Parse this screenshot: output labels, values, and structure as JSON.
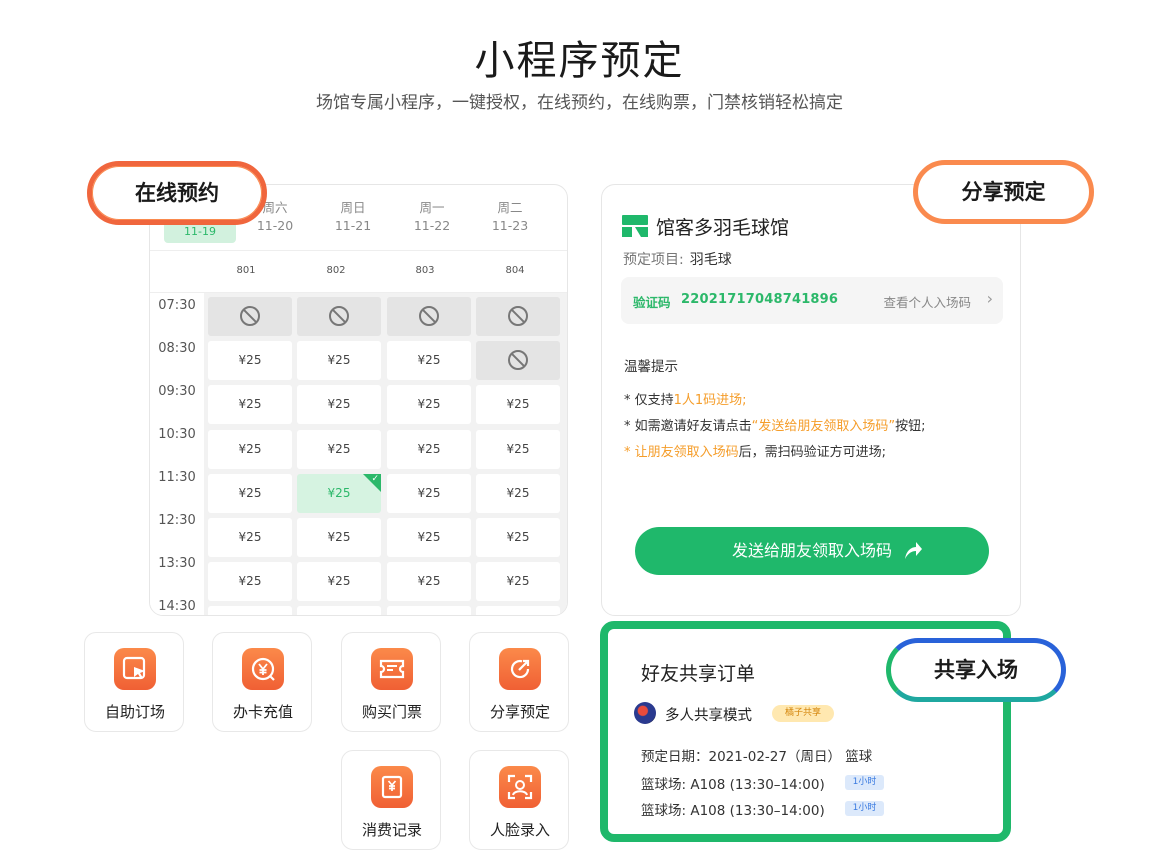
{
  "header": {
    "title": "小程序预定",
    "subtitle": "场馆专属小程序，一键授权，在线预约，在线购票，门禁核销轻松搞定"
  },
  "labels": {
    "online": "在线预约",
    "share": "分享预定",
    "enter": "共享入场"
  },
  "booking": {
    "selected_day": "11-19",
    "days": [
      {
        "week": "周六",
        "date": "11-20"
      },
      {
        "week": "周日",
        "date": "11-21"
      },
      {
        "week": "周一",
        "date": "11-22"
      },
      {
        "week": "周二",
        "date": "11-23"
      }
    ],
    "courts": [
      "801",
      "802",
      "803",
      "804"
    ],
    "times": [
      "07:30",
      "08:30",
      "09:30",
      "10:30",
      "11:30",
      "12:30",
      "13:30",
      "14:30"
    ],
    "price": "¥25",
    "rows": [
      [
        "off",
        "off",
        "off",
        "off"
      ],
      [
        "avail",
        "avail",
        "avail",
        "off"
      ],
      [
        "avail",
        "avail",
        "avail",
        "avail"
      ],
      [
        "avail",
        "avail",
        "avail",
        "avail"
      ],
      [
        "avail",
        "selected",
        "avail",
        "avail"
      ],
      [
        "avail",
        "avail",
        "avail",
        "avail"
      ],
      [
        "avail",
        "avail",
        "avail",
        "avail"
      ],
      [
        "avail",
        "avail",
        "avail",
        "avail"
      ]
    ]
  },
  "share_card": {
    "venue_name": "馆客多羽毛球馆",
    "project_label": "预定项目:",
    "project_value": "羽毛球",
    "code_label": "验证码",
    "code_value": "22021717048741896",
    "code_link": "查看个人入场码",
    "tips_title": "温馨提示",
    "tip1": {
      "prefix": "* 仅支持",
      "hl": "1人1码进场;",
      "suffix": ""
    },
    "tip2": {
      "prefix": "* 如需邀请好友请点击",
      "hl": "“发送给朋友领取入场码”",
      "suffix": "按钮;"
    },
    "tip3": {
      "prefix": "* ",
      "hl": "让朋友领取入场码",
      "suffix": "后，需扫码验证方可进场;"
    },
    "send_button": "发送给朋友领取入场码"
  },
  "tiles": [
    {
      "label": "自助订场",
      "icon": "cursor-icon"
    },
    {
      "label": "办卡充值",
      "icon": "yen-card-icon"
    },
    {
      "label": "购买门票",
      "icon": "ticket-icon"
    },
    {
      "label": "分享预定",
      "icon": "share-icon"
    },
    {
      "label": "消费记录",
      "icon": "receipt-icon"
    },
    {
      "label": "人脸录入",
      "icon": "face-scan-icon"
    }
  ],
  "order": {
    "title": "好友共享订单",
    "mode": "多人共享模式",
    "badge": "橘子共享",
    "date_line": "预定日期：2021-02-27（周日） 篮球",
    "lines": [
      {
        "text": "篮球场: A108 (13:30–14:00)",
        "badge": "1小时"
      },
      {
        "text": "篮球场: A108 (13:30–14:00)",
        "badge": "1小时"
      }
    ]
  },
  "colors": {
    "green": "#1fb86b",
    "orange": "#f0663d",
    "blue": "#2962d9"
  }
}
